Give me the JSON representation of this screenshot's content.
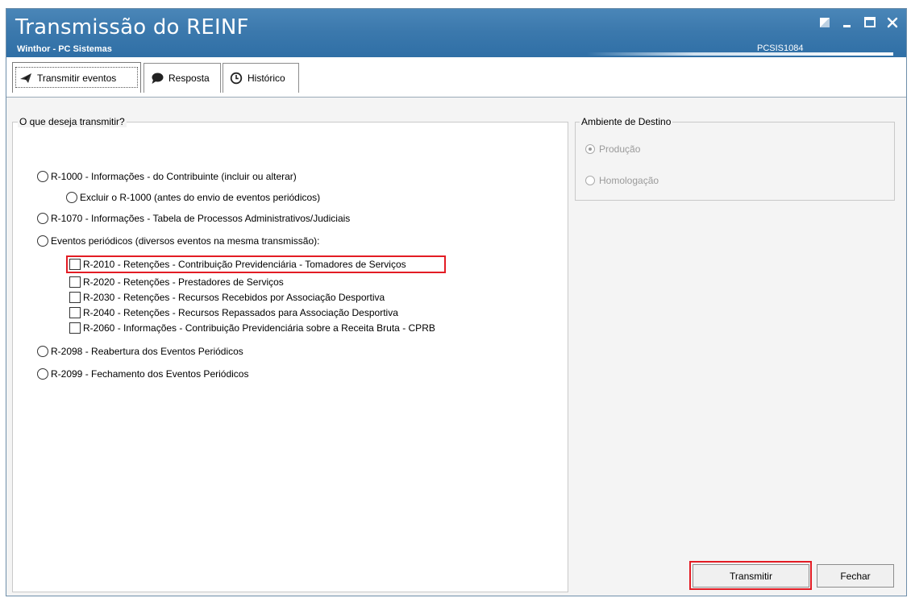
{
  "window": {
    "title": "Transmissão do REINF",
    "subtitle": "Winthor - PC Sistemas",
    "code": "PCSIS1084",
    "controls": [
      "restore-icon",
      "minimize-icon",
      "maximize-icon",
      "close-icon"
    ]
  },
  "tabs": [
    {
      "label": "Transmitir eventos",
      "icon": "send-icon",
      "active": true
    },
    {
      "label": "Resposta",
      "icon": "chat-bubble-icon",
      "active": false
    },
    {
      "label": "Histórico",
      "icon": "clock-icon",
      "active": false
    }
  ],
  "what_to_transmit": {
    "legend": "O que deseja transmitir?",
    "options": {
      "r1000": "R-1000 - Informações - do Contribuinte (incluir ou alterar)",
      "excluir_r1000": "Excluir o R-1000 (antes do envio de eventos periódicos)",
      "r1070": "R-1070 - Informações - Tabela de Processos Administrativos/Judiciais",
      "periodicos": "Eventos periódicos (diversos eventos na mesma transmissão):",
      "r2098": "R-2098 - Reabertura dos Eventos Periódicos",
      "r2099": "R-2099 - Fechamento dos Eventos Periódicos"
    },
    "periodic_events": [
      "R-2010 - Retenções - Contribuição Previdenciária - Tomadores de Serviços",
      "R-2020 - Retenções - Prestadores de Serviços",
      "R-2030 - Retenções - Recursos Recebidos por Associação Desportiva",
      "R-2040 - Retenções - Recursos Repassados para Associação Desportiva",
      "R-2060 - Informações - Contribuição Previdenciária sobre a Receita Bruta - CPRB"
    ]
  },
  "environment": {
    "legend": "Ambiente de Destino",
    "options": [
      "Produção",
      "Homologação"
    ],
    "selected": "Produção"
  },
  "buttons": {
    "transmit": "Transmitir",
    "close": "Fechar"
  },
  "colors": {
    "title_bar": "#3c79ad",
    "highlight": "#e31c24"
  }
}
